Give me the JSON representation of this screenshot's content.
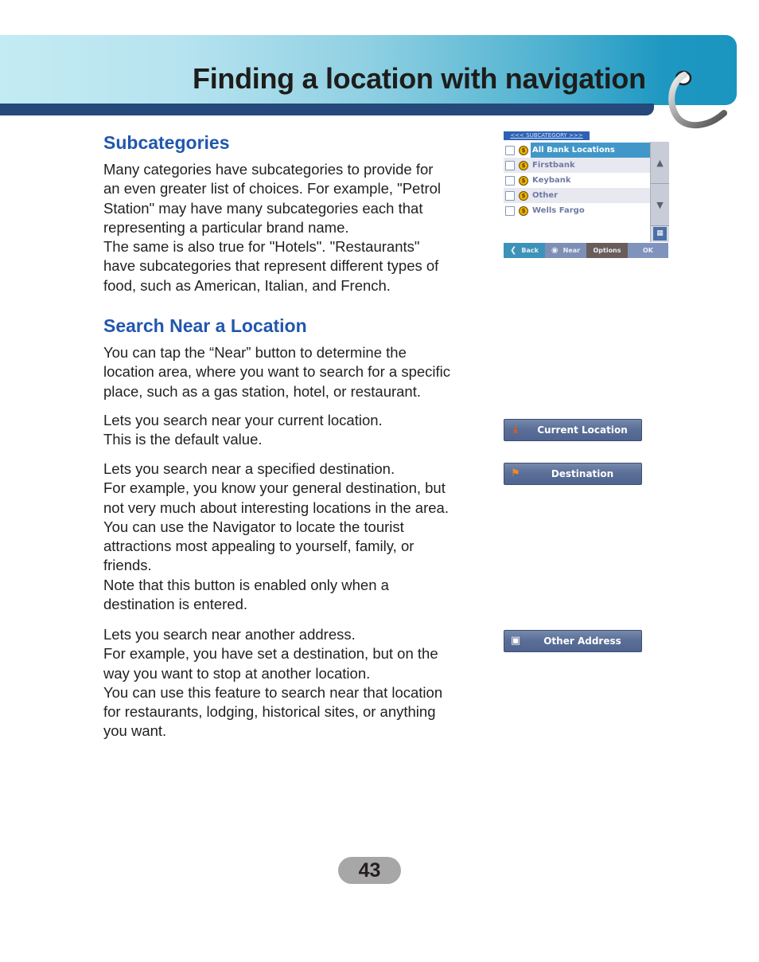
{
  "header": {
    "title": "Finding a location with navigation",
    "ring_icon": "binder-ring-icon"
  },
  "sections": {
    "subcategories": {
      "heading": "Subcategories",
      "lines": [
        "Many categories have subcategories to provide for",
        "an even greater list of choices. For example, \"Petrol",
        "Station\" may have many subcategories each that",
        "representing a particular brand name.",
        "The same is also true for \"Hotels\". \"Restaurants\"",
        "have subcategories that represent different types of",
        "food, such as American, Italian, and French."
      ]
    },
    "search_near": {
      "heading": "Search Near a Location",
      "intro_lines": [
        "You can tap the “Near” button to determine the",
        "location area, where you want to search for a specific",
        "place, such as a gas station, hotel, or restaurant."
      ],
      "current_location_lines": [
        "Lets you search near your current location.",
        "This is the default value."
      ],
      "destination_lines": [
        "Lets you search near a specified destination.",
        "For example, you know your general destination, but",
        "not very much about interesting locations in the area.",
        "You can use the Navigator to locate the tourist",
        "attractions most appealing to yourself, family, or",
        "friends.",
        "Note that this button is enabled only when a",
        "destination is entered."
      ],
      "other_address_lines": [
        "Lets you search near another address.",
        "For example, you have set a destination, but on the",
        "way you want to stop at another location.",
        "You can use this feature to search near that location",
        "for restaurants, lodging, historical sites, or anything",
        "you want."
      ]
    }
  },
  "device_screen": {
    "breadcrumb": "<<< SUBCATEGORY >>>",
    "items": [
      {
        "label": "All Bank Locations",
        "selected": true,
        "icon": "dollar-coin-icon"
      },
      {
        "label": "Firstbank",
        "selected": false,
        "icon": "dollar-coin-icon"
      },
      {
        "label": "Keybank",
        "selected": false,
        "icon": "dollar-coin-icon"
      },
      {
        "label": "Other",
        "selected": false,
        "icon": "dollar-coin-icon"
      },
      {
        "label": "Wells Fargo",
        "selected": false,
        "icon": "dollar-coin-icon"
      }
    ],
    "toolbar": {
      "back": "Back",
      "near": "Near",
      "options": "Options",
      "ok": "OK"
    },
    "coin_glyph": "$"
  },
  "buttons": {
    "current_location": "Current Location",
    "destination": "Destination",
    "other_address": "Other Address"
  },
  "footer": {
    "page_number": "43"
  },
  "colors": {
    "heading_blue": "#2157ad",
    "banner_dark": "#24497a",
    "button_blue": "#5b6f98",
    "page_badge": "#a7a7a8"
  }
}
